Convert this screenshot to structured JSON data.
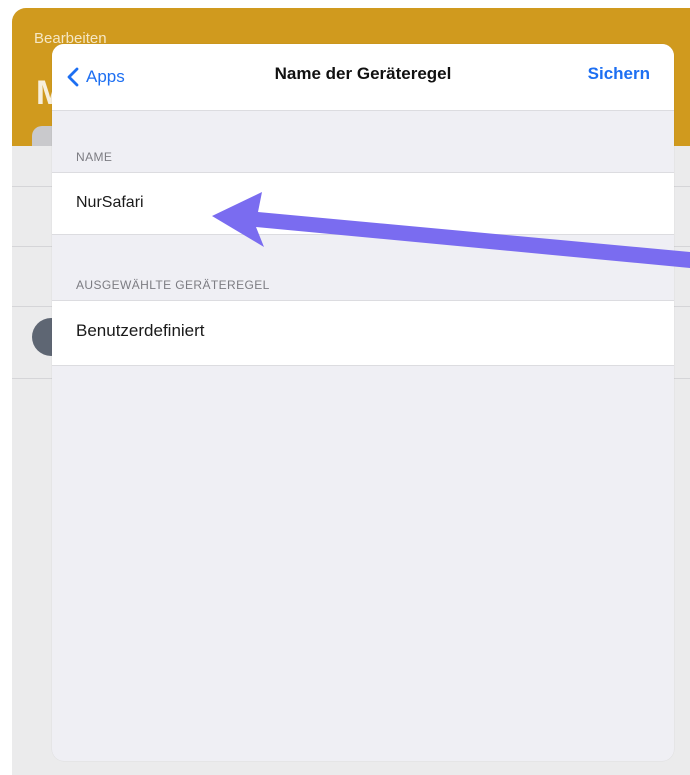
{
  "background_app": {
    "edit_label": "Bearbeiten",
    "large_title_fragment": "M",
    "header_color": "#d09a1e"
  },
  "sheet": {
    "navbar": {
      "back_label": "Apps",
      "back_icon": "chevron-left-icon",
      "title": "Name der Geräteregel",
      "save_label": "Sichern"
    },
    "sections": [
      {
        "header": "NAME",
        "value": "NurSafari"
      },
      {
        "header": "AUSGEWÄHLTE GERÄTEREGEL",
        "value": "Benutzerdefiniert"
      }
    ]
  },
  "annotation": {
    "icon": "arrow-pointer-icon",
    "color": "#7a6cf0"
  },
  "colors": {
    "accent": "#1d6ff2",
    "sheet_background": "#efeff4"
  }
}
